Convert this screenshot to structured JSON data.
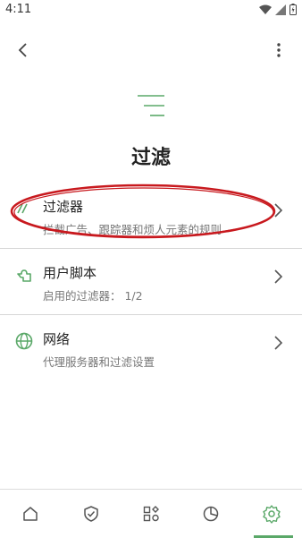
{
  "status": {
    "time": "4:11"
  },
  "header": {
    "title": "过滤"
  },
  "rows": [
    {
      "title": "过滤器",
      "subtitle": "拦截广告、跟踪器和烦人元素的规则"
    },
    {
      "title": "用户脚本",
      "subtitle": "启用的过滤器：  1/2"
    },
    {
      "title": "网络",
      "subtitle": "代理服务器和过滤设置"
    }
  ],
  "colors": {
    "accent": "#5aa868",
    "annotation": "#c8191e"
  },
  "icons": {
    "back": "arrow-back-icon",
    "more": "more-vert-icon",
    "nav": [
      "home-icon",
      "shield-check-icon",
      "apps-icon",
      "pie-chart-icon",
      "gear-icon"
    ],
    "nav_active_index": 4
  }
}
